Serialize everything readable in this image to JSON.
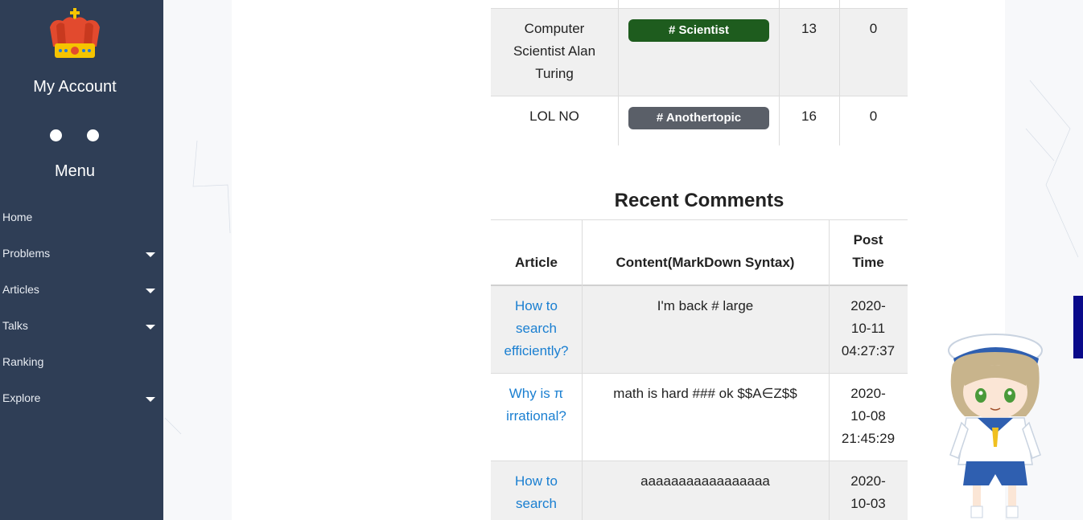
{
  "sidebar": {
    "account_title": "My Account",
    "menu_title": "Menu",
    "items": [
      {
        "label": "Home",
        "has_submenu": false
      },
      {
        "label": "Problems",
        "has_submenu": true
      },
      {
        "label": "Articles",
        "has_submenu": true
      },
      {
        "label": "Talks",
        "has_submenu": true
      },
      {
        "label": "Ranking",
        "has_submenu": false
      },
      {
        "label": "Explore",
        "has_submenu": true
      }
    ]
  },
  "articles_table": {
    "rows": [
      {
        "title": "Computer Scientist Alan Turing",
        "title_lines": [
          "Computer",
          "Scientist Alan",
          "Turing"
        ],
        "tag": "# Scientist",
        "tag_color": "#1e5c1e",
        "col3": "13",
        "col4": "0"
      },
      {
        "title": "LOL NO",
        "title_lines": [
          "LOL NO"
        ],
        "tag": "# Anothertopic",
        "tag_color": "#5a5f68",
        "col3": "16",
        "col4": "0"
      }
    ]
  },
  "recent_comments": {
    "title": "Recent Comments",
    "headers": {
      "article": "Article",
      "content": "Content(MarkDown Syntax)",
      "post_time_l1": "Post",
      "post_time_l2": "Time"
    },
    "rows": [
      {
        "article_lines": [
          "How to",
          "search",
          "efficiently?"
        ],
        "content": "I'm back # large",
        "time_lines": [
          "2020-",
          "10-11",
          "04:27:37"
        ]
      },
      {
        "article_lines": [
          "Why is π",
          "irrational?"
        ],
        "content": "math is hard ### ok $$A∈Z$$",
        "time_lines": [
          "2020-",
          "10-08",
          "21:45:29"
        ]
      },
      {
        "article_lines": [
          "How to",
          "search"
        ],
        "content": "aaaaaaaaaaaaaaaaa",
        "time_lines": [
          "2020-",
          "10-03"
        ]
      }
    ]
  },
  "colors": {
    "sidebar_bg": "#2f3e56",
    "link": "#1a7fd1",
    "row_alt": "#f0f0f0"
  }
}
